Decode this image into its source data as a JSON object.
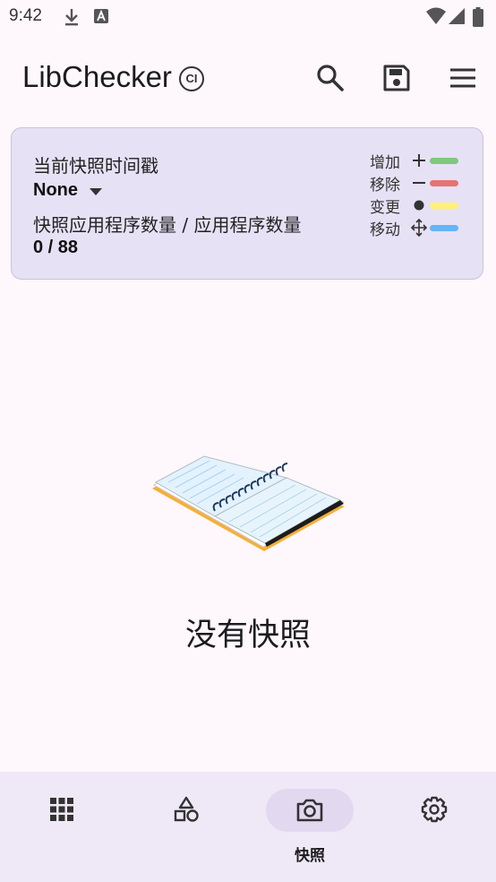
{
  "status_bar": {
    "time": "9:42",
    "icons": [
      "download-icon",
      "a-app-icon",
      "wifi-icon",
      "cell-signal-icon",
      "battery-icon"
    ]
  },
  "toolbar": {
    "title": "LibChecker",
    "badge": "CI",
    "actions": [
      "search-icon",
      "save-icon",
      "menu-icon"
    ]
  },
  "snapshot_card": {
    "timestamp_label": "当前快照时间戳",
    "timestamp_value": "None",
    "count_label": "快照应用程序数量 / 应用程序数量",
    "count_value": "0 / 88",
    "legend": [
      {
        "label": "增加",
        "symbol": "plus",
        "color": "#7ec97c"
      },
      {
        "label": "移除",
        "symbol": "minus",
        "color": "#e57373"
      },
      {
        "label": "变更",
        "symbol": "dot",
        "color": "#fff176"
      },
      {
        "label": "移动",
        "symbol": "move",
        "color": "#64b5f6"
      }
    ]
  },
  "empty_state": {
    "illustration": "notebook-illustration",
    "message": "没有快照"
  },
  "bottom_nav": {
    "items": [
      {
        "name": "apps",
        "icon": "grid-icon",
        "label": ""
      },
      {
        "name": "statistics",
        "icon": "shapes-icon",
        "label": ""
      },
      {
        "name": "snapshot",
        "icon": "camera-icon",
        "label": "快照",
        "active": true
      },
      {
        "name": "settings",
        "icon": "gear-icon",
        "label": ""
      }
    ]
  },
  "colors": {
    "background": "#fef7fc",
    "card": "#e7e1f5",
    "nav_bar": "#efe8f6",
    "active_pill": "#e2d9f0"
  }
}
